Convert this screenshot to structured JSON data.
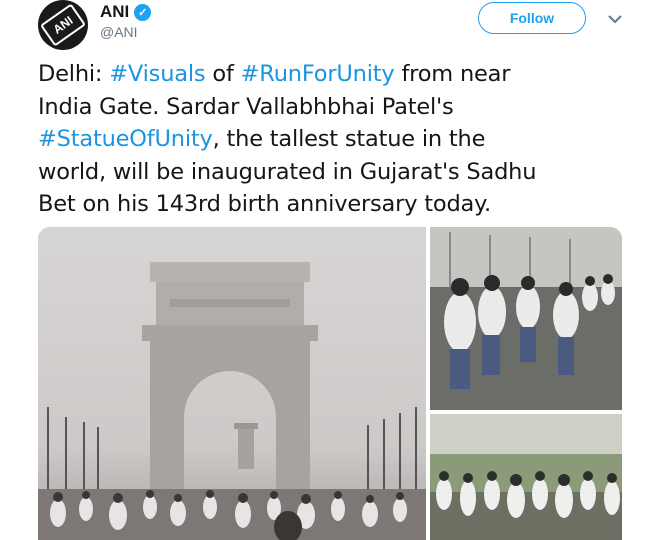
{
  "tweet": {
    "author_name": "ANI",
    "handle": "@ANI",
    "avatar_text": "ANI",
    "verified": true,
    "follow_label": "Follow",
    "text_lines": [
      [
        {
          "text": "Delhi: ",
          "hashtag": false
        },
        {
          "text": "#Visuals",
          "hashtag": true
        },
        {
          "text": " of ",
          "hashtag": false
        },
        {
          "text": "#RunForUnity",
          "hashtag": true
        },
        {
          "text": " from near",
          "hashtag": false
        }
      ],
      [
        {
          "text": "India Gate. Sardar Vallabhbhai Patel's",
          "hashtag": false
        }
      ],
      [
        {
          "text": "#StatueOfUnity",
          "hashtag": true
        },
        {
          "text": ", the tallest statue in the",
          "hashtag": false
        }
      ],
      [
        {
          "text": "world, will be inaugurated in Gujarat's Sadhu",
          "hashtag": false
        }
      ],
      [
        {
          "text": "Bet on his 143rd birth anniversary today.",
          "hashtag": false
        }
      ]
    ],
    "media": [
      {
        "name": "india-gate-photo"
      },
      {
        "name": "runners-closeup-photo"
      },
      {
        "name": "runners-crowd-photo"
      }
    ]
  },
  "colors": {
    "accent": "#1da1f2",
    "hashtag": "#1b95e0",
    "text": "#14171a",
    "secondary": "#657786"
  },
  "icons": {
    "verified": "verified-badge-icon",
    "caret": "chevron-down-icon"
  }
}
